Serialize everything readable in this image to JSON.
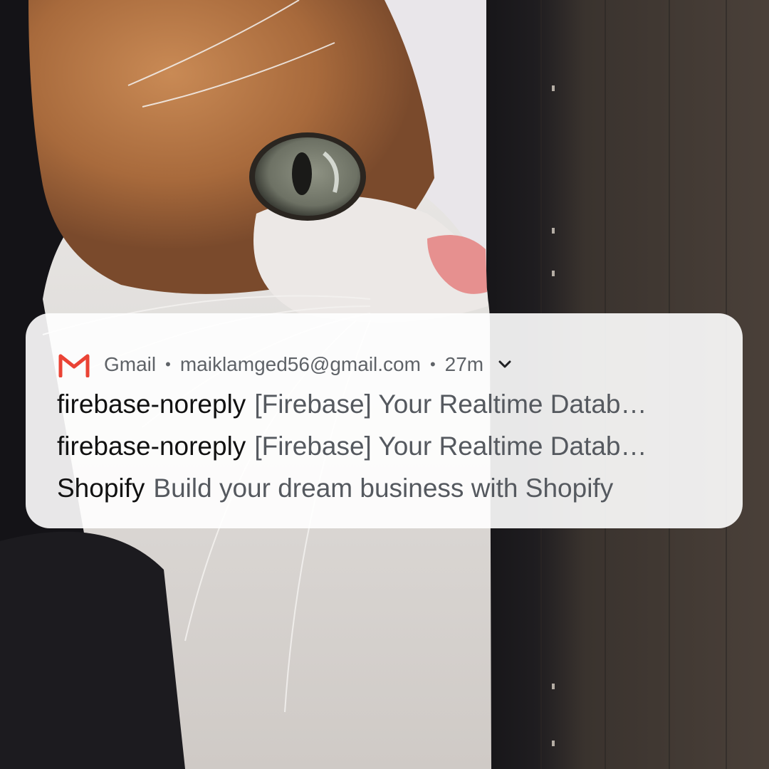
{
  "notification": {
    "app_name": "Gmail",
    "account": "maiklamged56@gmail.com",
    "time": "27m",
    "separator": "•",
    "icons": {
      "app": "gmail-icon",
      "expand": "chevron-down-icon"
    },
    "colors": {
      "gmail_red": "#EA4335"
    },
    "messages": [
      {
        "sender": "firebase-noreply",
        "subject": "[Firebase] Your Realtime Datab…"
      },
      {
        "sender": "firebase-noreply",
        "subject": "[Firebase] Your Realtime Datab…"
      },
      {
        "sender": "Shopify",
        "subject": "Build your dream business with Shopify"
      }
    ]
  }
}
